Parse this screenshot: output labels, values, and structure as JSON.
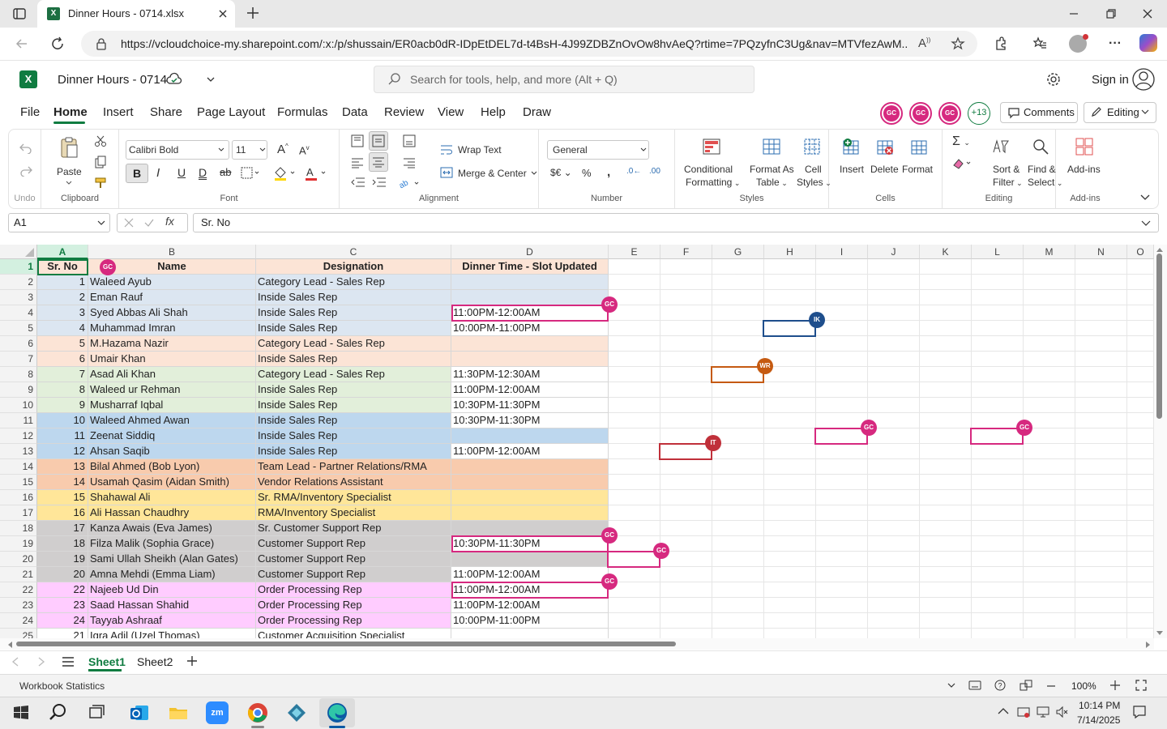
{
  "browser": {
    "tab_title": "Dinner Hours - 0714.xlsx",
    "url": "https://vcloudchoice-my.sharepoint.com/:x:/p/shussain/ER0acb0dR-IDpEtDEL7d-t4BsH-4J99ZDBZnOvOw8hvAeQ?rtime=7PQzyfnC3Ug&nav=MTVfezAwM..."
  },
  "app": {
    "file_title": "Dinner Hours - 0714",
    "search_placeholder": "Search for tools, help, and more (Alt + Q)",
    "sign_in": "Sign in"
  },
  "menu": [
    "File",
    "Home",
    "Insert",
    "Share",
    "Page Layout",
    "Formulas",
    "Data",
    "Review",
    "View",
    "Help",
    "Draw"
  ],
  "menu_active": "Home",
  "collab": {
    "avatars": [
      "GC",
      "GC",
      "GC"
    ],
    "more": "+13",
    "comments": "Comments",
    "editing": "Editing"
  },
  "ribbon": {
    "undo": "Undo",
    "paste": "Paste",
    "clipboard": "Clipboard",
    "font_name": "Calibri Bold",
    "font_size": "11",
    "font": "Font",
    "wrap_text": "Wrap Text",
    "merge_center": "Merge & Center",
    "alignment": "Alignment",
    "number_format": "General",
    "number": "Number",
    "cond_format_1": "Conditional",
    "cond_format_2": "Formatting",
    "format_table_1": "Format As",
    "format_table_2": "Table",
    "cell_styles_1": "Cell",
    "cell_styles_2": "Styles",
    "styles": "Styles",
    "insert": "Insert",
    "delete": "Delete",
    "format": "Format",
    "cells": "Cells",
    "sort_1": "Sort &",
    "sort_2": "Filter",
    "find_1": "Find &",
    "find_2": "Select",
    "editing": "Editing",
    "addins": "Add-ins",
    "addins_group": "Add-ins"
  },
  "formula_bar": {
    "name_box": "A1",
    "fx": "fx",
    "value": "Sr. No"
  },
  "columns": [
    "A",
    "B",
    "C",
    "D",
    "E",
    "F",
    "G",
    "H",
    "I",
    "J",
    "K",
    "L",
    "M",
    "N",
    "O"
  ],
  "header_row": [
    "Sr. No",
    "Name",
    "Designation",
    "Dinner Time - Slot Updated"
  ],
  "rows": [
    {
      "n": "1",
      "name": "Waleed Ayub",
      "des": "Category Lead - Sales Rep",
      "time": "",
      "color": "#dce6f1"
    },
    {
      "n": "2",
      "name": "Eman Rauf",
      "des": "Inside Sales Rep",
      "time": "",
      "color": "#dce6f1"
    },
    {
      "n": "3",
      "name": "Syed Abbas Ali Shah",
      "des": "Inside Sales Rep",
      "time": "11:00PM-12:00AM",
      "color": "#dce6f1"
    },
    {
      "n": "4",
      "name": "Muhammad Imran",
      "des": "Inside Sales Rep",
      "time": "10:00PM-11:00PM",
      "color": "#dce6f1"
    },
    {
      "n": "5",
      "name": "M.Hazama Nazir",
      "des": "Category Lead - Sales Rep",
      "time": "",
      "color": "#fce4d6"
    },
    {
      "n": "6",
      "name": "Umair Khan",
      "des": "Inside Sales Rep",
      "time": "",
      "color": "#fce4d6"
    },
    {
      "n": "7",
      "name": "Asad Ali Khan",
      "des": "Category Lead - Sales Rep",
      "time": "11:30PM-12:30AM",
      "color": "#e2efda"
    },
    {
      "n": "8",
      "name": "Waleed ur Rehman",
      "des": "Inside Sales Rep",
      "time": "11:00PM-12:00AM",
      "color": "#e2efda"
    },
    {
      "n": "9",
      "name": "Musharraf Iqbal",
      "des": "Inside Sales Rep",
      "time": "10:30PM-11:30PM",
      "color": "#e2efda"
    },
    {
      "n": "10",
      "name": "Waleed Ahmed Awan",
      "des": "Inside Sales Rep",
      "time": "10:30PM-11:30PM",
      "color": "#bdd7ee"
    },
    {
      "n": "11",
      "name": "Zeenat Siddiq",
      "des": "Inside Sales Rep",
      "time": "",
      "color": "#bdd7ee"
    },
    {
      "n": "12",
      "name": "Ahsan Saqib",
      "des": "Inside Sales Rep",
      "time": "11:00PM-12:00AM",
      "color": "#bdd7ee"
    },
    {
      "n": "13",
      "name": "Bilal Ahmed (Bob Lyon)",
      "des": "Team Lead - Partner Relations/RMA",
      "time": "",
      "color": "#f8cbad"
    },
    {
      "n": "14",
      "name": "Usamah Qasim (Aidan Smith)",
      "des": "Vendor Relations Assistant",
      "time": "",
      "color": "#f8cbad"
    },
    {
      "n": "15",
      "name": "Shahawal Ali",
      "des": "Sr. RMA/Inventory Specialist",
      "time": "",
      "color": "#ffe699"
    },
    {
      "n": "16",
      "name": "Ali Hassan Chaudhry",
      "des": "RMA/Inventory Specialist",
      "time": "",
      "color": "#ffe699"
    },
    {
      "n": "17",
      "name": "Kanza Awais (Eva James)",
      "des": "Sr. Customer Support Rep",
      "time": "",
      "color": "#d0cece"
    },
    {
      "n": "18",
      "name": "Filza Malik (Sophia Grace)",
      "des": "Customer Support Rep",
      "time": "10:30PM-11:30PM",
      "color": "#d0cece"
    },
    {
      "n": "19",
      "name": "Sami Ullah Sheikh (Alan Gates)",
      "des": "Customer Support Rep",
      "time": "",
      "color": "#d0cece"
    },
    {
      "n": "20",
      "name": "Amna Mehdi (Emma Liam)",
      "des": "Customer Support Rep",
      "time": "11:00PM-12:00AM",
      "color": "#d0cece"
    },
    {
      "n": "22",
      "name": "Najeeb Ud Din",
      "des": "Order Processing Rep",
      "time": "11:00PM-12:00AM",
      "color": "#ffccff"
    },
    {
      "n": "23",
      "name": "Saad Hassan Shahid",
      "des": "Order Processing Rep",
      "time": "11:00PM-12:00AM",
      "color": "#ffccff"
    },
    {
      "n": "24",
      "name": "Tayyab Ashraaf",
      "des": "Order Processing Rep",
      "time": "10:00PM-11:00PM",
      "color": "#ffccff"
    },
    {
      "n": "21",
      "name": "Iqra Adil (Uzel Thomas)",
      "des": "Customer Acquisition Specialist",
      "time": "",
      "color": "#ffffff"
    }
  ],
  "presence": [
    {
      "initials": "GC",
      "color": "#d6297f"
    },
    {
      "initials": "IK",
      "color": "#1e4e8c"
    },
    {
      "initials": "WR",
      "color": "#c55a11"
    },
    {
      "initials": "GC",
      "color": "#d6297f"
    },
    {
      "initials": "GC",
      "color": "#d6297f"
    },
    {
      "initials": "IT",
      "color": "#c0303a"
    },
    {
      "initials": "GC",
      "color": "#d6297f"
    },
    {
      "initials": "GC",
      "color": "#d6297f"
    },
    {
      "initials": "GC",
      "color": "#d6297f"
    },
    {
      "initials": "GC",
      "color": "#d6297f"
    }
  ],
  "sheets": [
    "Sheet1",
    "Sheet2"
  ],
  "status": {
    "left": "Workbook Statistics",
    "zoom": "100%"
  },
  "clock": {
    "time": "10:14 PM",
    "date": "7/14/2025"
  }
}
